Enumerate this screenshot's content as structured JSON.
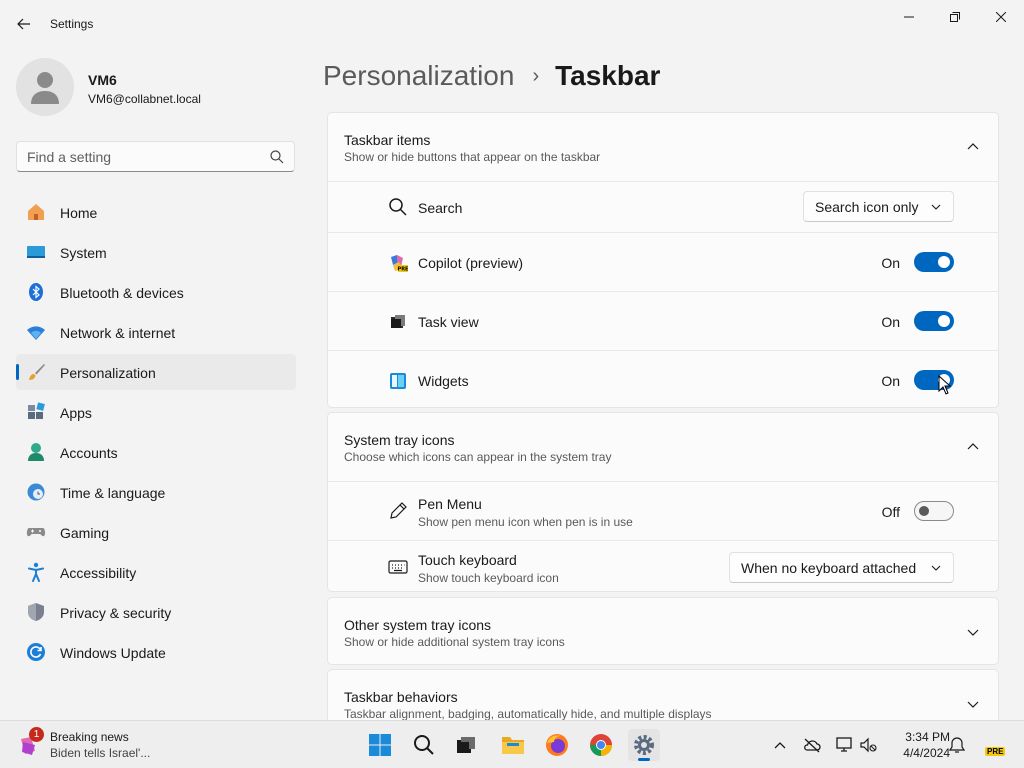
{
  "window": {
    "title": "Settings"
  },
  "profile": {
    "name": "VM6",
    "email": "VM6@collabnet.local"
  },
  "search": {
    "placeholder": "Find a setting"
  },
  "sidebar": {
    "items": [
      {
        "label": "Home",
        "icon": "home-icon"
      },
      {
        "label": "System",
        "icon": "system-icon"
      },
      {
        "label": "Bluetooth & devices",
        "icon": "bluetooth-icon"
      },
      {
        "label": "Network & internet",
        "icon": "wifi-icon"
      },
      {
        "label": "Personalization",
        "icon": "brush-icon",
        "active": true
      },
      {
        "label": "Apps",
        "icon": "apps-icon"
      },
      {
        "label": "Accounts",
        "icon": "accounts-icon"
      },
      {
        "label": "Time & language",
        "icon": "clock-globe-icon"
      },
      {
        "label": "Gaming",
        "icon": "gamepad-icon"
      },
      {
        "label": "Accessibility",
        "icon": "accessibility-icon"
      },
      {
        "label": "Privacy & security",
        "icon": "shield-icon"
      },
      {
        "label": "Windows Update",
        "icon": "update-icon"
      }
    ]
  },
  "breadcrumb": {
    "parent": "Personalization",
    "separator": "›",
    "current": "Taskbar"
  },
  "taskbar_items": {
    "title": "Taskbar items",
    "desc": "Show or hide buttons that appear on the taskbar",
    "search": {
      "label": "Search",
      "value": "Search icon only"
    },
    "copilot": {
      "label": "Copilot (preview)",
      "state": "On"
    },
    "taskview": {
      "label": "Task view",
      "state": "On"
    },
    "widgets": {
      "label": "Widgets",
      "state": "On"
    }
  },
  "system_tray": {
    "title": "System tray icons",
    "desc": "Choose which icons can appear in the system tray",
    "pen": {
      "label": "Pen Menu",
      "sub": "Show pen menu icon when pen is in use",
      "state": "Off"
    },
    "touch": {
      "label": "Touch keyboard",
      "sub": "Show touch keyboard icon",
      "value": "When no keyboard attached"
    }
  },
  "other_tray": {
    "title": "Other system tray icons",
    "desc": "Show or hide additional system tray icons"
  },
  "behaviors": {
    "title": "Taskbar behaviors",
    "desc": "Taskbar alignment, badging, automatically hide, and multiple displays"
  },
  "taskbar": {
    "news": {
      "title": "Breaking news",
      "sub": "Biden tells Israel'...",
      "badge": "1"
    },
    "clock": {
      "time": "3:34 PM",
      "date": "4/4/2024"
    },
    "pre": "PRE"
  },
  "colors": {
    "accent": "#0067c0",
    "background": "#f3f3f3",
    "card": "#fbfbfb"
  }
}
